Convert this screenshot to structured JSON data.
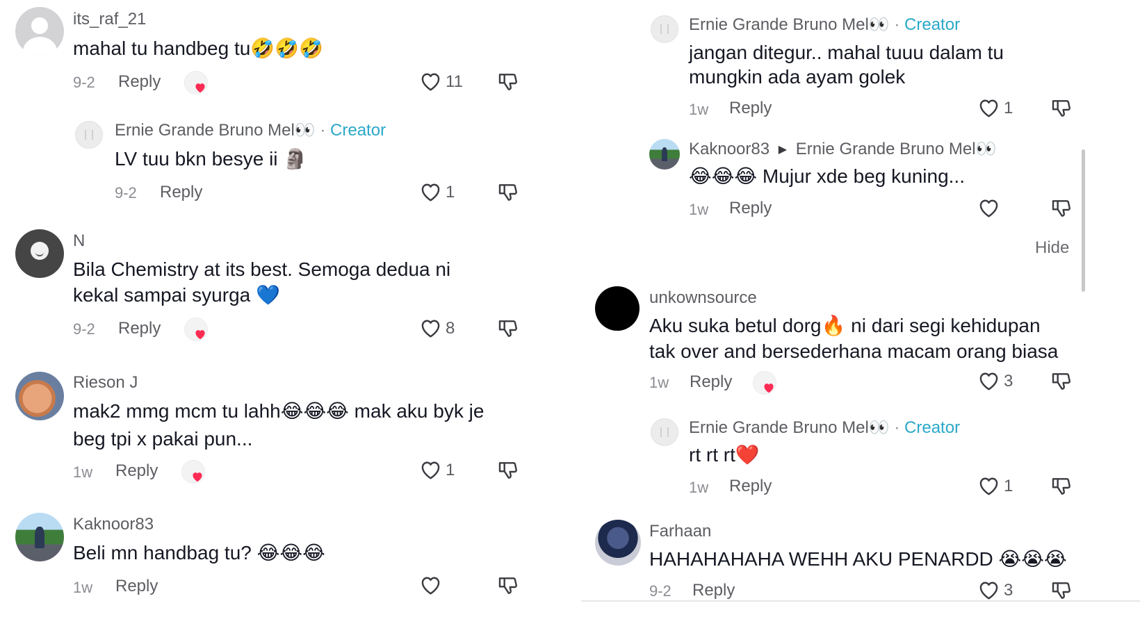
{
  "left_column": {
    "comments": [
      {
        "username": "its_raf_21",
        "text": "mahal tu handbeg tu🤣🤣🤣",
        "date": "9-2",
        "reply_label": "Reply",
        "likes": "11",
        "creator_liked": true
      },
      {
        "username": "Ernie Grande Bruno Mel👀",
        "creator_label": "Creator",
        "text": "LV tuu bkn besye ii 🗿",
        "date": "9-2",
        "reply_label": "Reply",
        "likes": "1"
      },
      {
        "username": "N",
        "text_line1": "Bila Chemistry at its best. Semoga dedua ni",
        "text_line2": "kekal sampai syurga 💙",
        "date": "9-2",
        "reply_label": "Reply",
        "likes": "8",
        "creator_liked": true
      },
      {
        "username": "Rieson J",
        "text_line1": "mak2 mmg mcm tu lahh😂😂😂 mak aku byk je",
        "text_line2": "beg tpi x pakai pun...",
        "date": "1w",
        "reply_label": "Reply",
        "likes": "1",
        "creator_liked": true
      },
      {
        "username": "Kaknoor83",
        "text": "Beli mn handbag tu? 😂😂😂",
        "date": "1w",
        "reply_label": "Reply",
        "likes": ""
      }
    ]
  },
  "right_column": {
    "comments": [
      {
        "username": "Ernie Grande Bruno Mel👀",
        "creator_label": "Creator",
        "text_line1": "jangan ditegur.. mahal tuuu dalam tu",
        "text_line2": "mungkin ada ayam golek",
        "date": "1w",
        "reply_label": "Reply",
        "likes": "1"
      },
      {
        "username": "Kaknoor83",
        "reply_to": "Ernie Grande Bruno Mel👀",
        "text": "😂😂😂 Mujur xde beg kuning...",
        "date": "1w",
        "reply_label": "Reply",
        "likes": ""
      },
      {
        "username": "unkownsource",
        "text_line1": "Aku suka betul dorg🔥 ni dari segi kehidupan",
        "text_line2": "tak over and bersederhana macam orang biasa",
        "date": "1w",
        "reply_label": "Reply",
        "likes": "3",
        "creator_liked": true
      },
      {
        "username": "Ernie Grande Bruno Mel👀",
        "creator_label": "Creator",
        "text": "rt rt rt❤️",
        "date": "1w",
        "reply_label": "Reply",
        "likes": "1"
      },
      {
        "username": "Farhaan",
        "text": "HAHAHAHAHA WEHH AKU PENARDD 😭😭😭",
        "date": "9-2",
        "reply_label": "Reply",
        "likes": "3"
      }
    ],
    "hide_label": "Hide"
  },
  "separator": "·",
  "colors": {
    "creator_accent": "#2aa8c8",
    "heart_red": "#fe2c55",
    "text_primary": "#161823",
    "text_secondary": "#8a8b91"
  },
  "icons": {
    "like": "heart-outline-icon",
    "dislike": "thumbs-down-icon",
    "creator_liked": "creator-liked-heart-icon",
    "reply_arrow": "triangle-right-icon"
  }
}
